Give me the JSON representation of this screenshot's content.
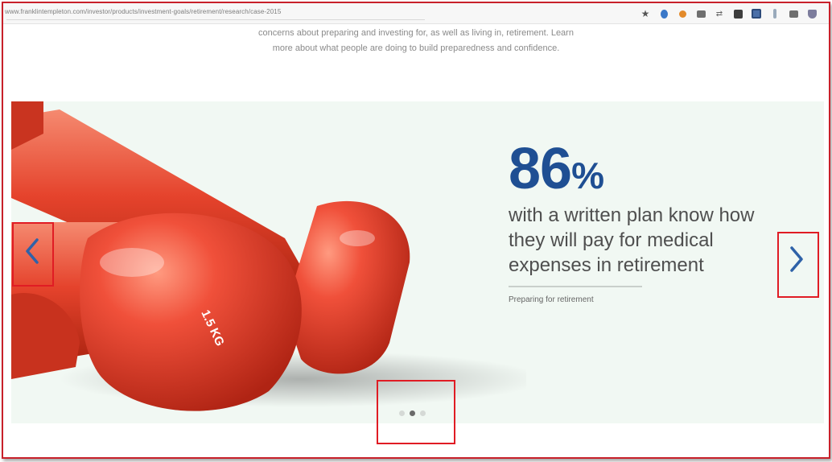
{
  "browser": {
    "url": "www.franklintempleton.com/investor/products/investment-goals/retirement/research/case-2015",
    "extension_icons": [
      "star-icon",
      "extension-blue-icon",
      "extension-orange-icon",
      "extension-gray-icon",
      "extension-dark-icon",
      "extension-doc-icon",
      "extension-light-icon",
      "extension-box-icon",
      "shield-icon"
    ]
  },
  "intro": {
    "line1": "concerns about preparing and investing for, as well as living in, retirement. Learn",
    "line2": "more about what people are doing to build preparedness and confidence."
  },
  "slide": {
    "stat_number": "86",
    "stat_percent": "%",
    "stat_text_line1": "with a written plan know how",
    "stat_text_line2": "they will pay for medical",
    "stat_text_line3": "expenses in retirement",
    "source": "Preparing for retirement",
    "dumbbell_label": "1.5 KG"
  },
  "carousel": {
    "previous_icon": "chevron-left-icon",
    "next_icon": "chevron-right-icon",
    "dot_count": 3,
    "active_dot": 2
  },
  "colors": {
    "accent_blue": "#1f4f93",
    "dumbbell_red": "#e0402a",
    "slide_background": "#f1f8f3",
    "highlight_red": "#e01c24"
  }
}
